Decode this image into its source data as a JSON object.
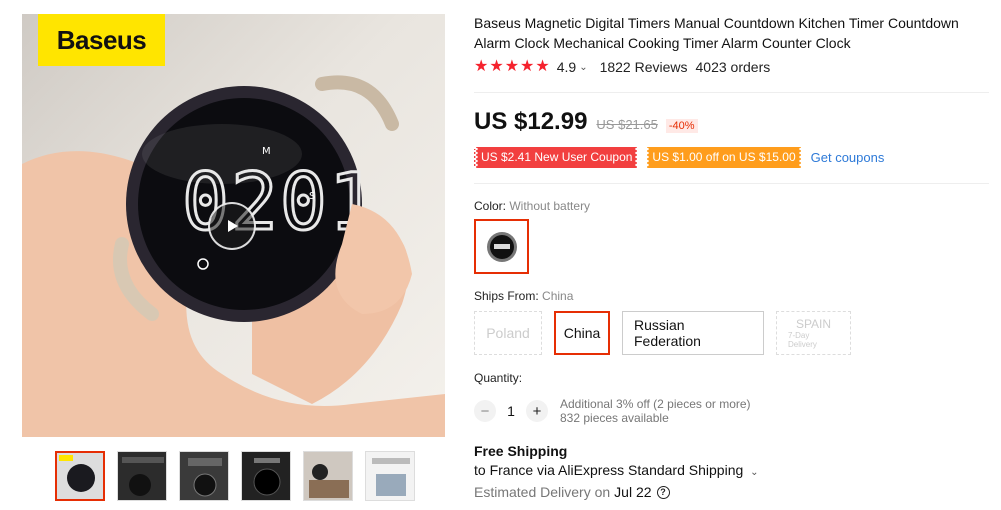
{
  "gallery": {
    "brand": "Baseus",
    "timer_display": "02:01",
    "thumbnails": [
      {
        "name": "thumb-1"
      },
      {
        "name": "thumb-2"
      },
      {
        "name": "thumb-3"
      },
      {
        "name": "thumb-4"
      },
      {
        "name": "thumb-5"
      },
      {
        "name": "thumb-6"
      }
    ]
  },
  "product": {
    "title": "Baseus Magnetic Digital Timers Manual Countdown Kitchen Timer Countdown Alarm Clock Mechanical Cooking Timer Alarm Counter Clock",
    "rating": "4.9",
    "reviews": "1822 Reviews",
    "orders": "4023 orders",
    "price": "US $12.99",
    "old_price": "US $21.65",
    "discount": "-40%",
    "coupons": [
      "US $2.41 New User Coupon",
      "US $1.00 off on US $15.00"
    ],
    "get_coupons": "Get coupons",
    "color_label": "Color:",
    "color_value": "Without battery",
    "ships_label": "Ships From:",
    "ships_value": "China",
    "ships_options": {
      "poland": "Poland",
      "china": "China",
      "russia": "Russian Federation",
      "spain": "SPAIN",
      "spain_sub": "7-Day Delivery"
    },
    "quantity_label": "Quantity:",
    "quantity_value": "1",
    "quantity_offer": "Additional 3% off (2 pieces or more)",
    "quantity_available": "832 pieces available",
    "free_shipping": "Free Shipping",
    "ship_to": "to France via AliExpress Standard Shipping",
    "eta_label": "Estimated Delivery on",
    "eta_date": "Jul 22"
  },
  "colors": {
    "accent": "#e62e04",
    "star": "#f5222d",
    "coupon_red": "#f23f3f",
    "coupon_orange": "#ff9d1c",
    "link": "#2e7ad8",
    "brand_yellow": "#ffe500"
  }
}
